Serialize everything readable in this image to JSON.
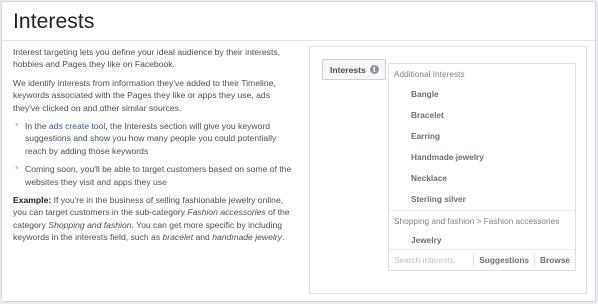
{
  "title": "Interests",
  "intro": "Interest targeting lets you define your ideal audience by their interests, hobbies and Pages they like on Facebook.",
  "identify": "We identify interests from information they've added to their Timeline, keywords associated with the Pages they like or apps they use, ads they've clicked on and other similar sources.",
  "bullet1": {
    "pre": "In the ",
    "link": "ads create tool",
    "post": ", the Interests section will give you keyword suggestions and show you how many people you could potentially reach by adding those keywords"
  },
  "bullet2": "Coming soon, you'll be able to target customers based on some of the websites they visit and apps they use",
  "example": {
    "label": "Example:",
    "t1": " If you're in the business of selling fashionable jewelry online, you can target customers in the sub-category ",
    "i1": "Fashion accessories",
    "t2": " of the category ",
    "i2": "Shopping and fashion",
    "t3": ". You can get more specific by including keywords in the interests field, such as ",
    "i3": "bracelet",
    "t4": " and ",
    "i4": "handmade jewelry",
    "t5": "."
  },
  "mock": {
    "button_label": "Interests",
    "info_icon": "i",
    "additional_header": "Additional Interests",
    "items": [
      "Bangle",
      "Bracelet",
      "Earring",
      "Handmade jewelry",
      "Necklace",
      "Sterling silver"
    ],
    "category_header": "Shopping and fashion > Fashion accessories",
    "category_items": [
      "Jewelry"
    ],
    "search_placeholder": "Search interests",
    "tab_suggestions": "Suggestions",
    "tab_browse": "Browse"
  }
}
